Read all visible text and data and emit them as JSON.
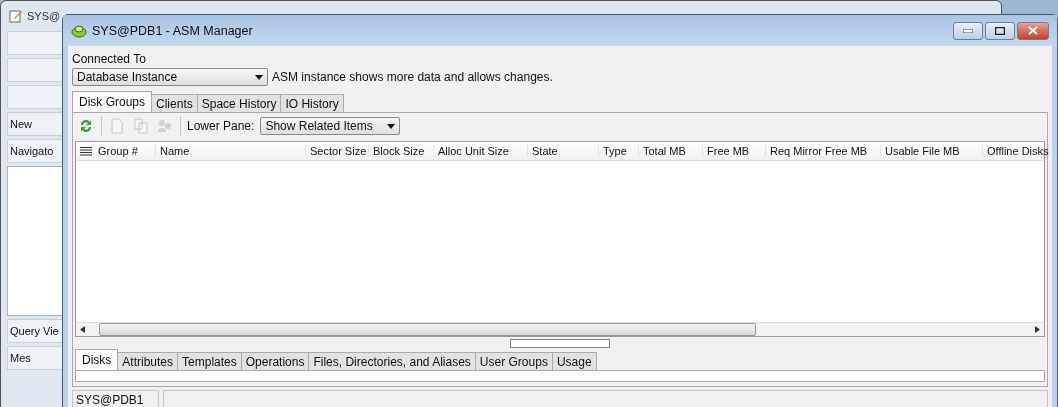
{
  "background_window": {
    "title": "SYS@",
    "tab": "New",
    "navigator": "Navigato",
    "query_viewer": "Query Vie",
    "messages": "Mes"
  },
  "window": {
    "title": "SYS@PDB1 - ASM Manager"
  },
  "connection": {
    "label": "Connected To",
    "value": "Database Instance",
    "hint": "ASM instance shows more data and allows changes."
  },
  "tabs": [
    {
      "label": "Disk Groups",
      "selected": true
    },
    {
      "label": "Clients",
      "selected": false
    },
    {
      "label": "Space History",
      "selected": false
    },
    {
      "label": "IO History",
      "selected": false
    }
  ],
  "toolbar": {
    "buttons": [
      {
        "kind": "refresh",
        "disabled": false
      },
      {
        "kind": "new",
        "disabled": true
      },
      {
        "kind": "copy",
        "disabled": true
      },
      {
        "kind": "users",
        "disabled": true
      }
    ],
    "lower_pane_label": "Lower Pane:",
    "lower_pane_value": "Show Related Items"
  },
  "table": {
    "columns": [
      "Group #",
      "Name",
      "Sector Size",
      "Block Size",
      "Alloc Unit Size",
      "State",
      "Type",
      "Total MB",
      "Free MB",
      "Req Mirror Free MB",
      "Usable File MB",
      "Offline Disks"
    ]
  },
  "lower_tabs": [
    {
      "label": "Disks",
      "selected": true
    },
    {
      "label": "Attributes",
      "selected": false
    },
    {
      "label": "Templates",
      "selected": false
    },
    {
      "label": "Operations",
      "selected": false
    },
    {
      "label": "Files, Directories, and Aliases",
      "selected": false
    },
    {
      "label": "User Groups",
      "selected": false
    },
    {
      "label": "Usage",
      "selected": false
    }
  ],
  "status_bar": {
    "connection": "SYS@PDB1"
  }
}
